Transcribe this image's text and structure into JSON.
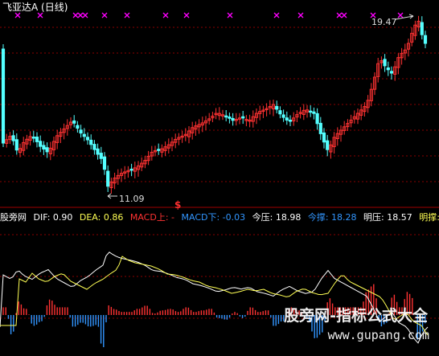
{
  "header": {
    "title": "飞亚达A (日线)"
  },
  "price_pane": {
    "high_label": "19.47",
    "low_label": "11.09",
    "signal_mark": "$"
  },
  "indicator_bar": {
    "name": "股旁网",
    "dif": "DIF: 0.90",
    "dea": "DEA: 0.86",
    "macd_up": "MACD上: -",
    "macd_down": "MACD下: -0.03",
    "jinya": "今压: 18.98",
    "jincheng": "今撑: 18.28",
    "mingya": "明压: 18.57",
    "mingcheng": "明撑:"
  },
  "watermark": {
    "line1": "股旁网-指标公式大全",
    "line2": "www.gupang.com"
  },
  "colors": {
    "up": "#ff3232",
    "down": "#54ffff",
    "dif": "#ffffff",
    "dea": "#ffff54",
    "hist_up": "#ff3232",
    "hist_down": "#3296ff",
    "marker": "#ff00ff",
    "grid": "#8b0000"
  }
}
